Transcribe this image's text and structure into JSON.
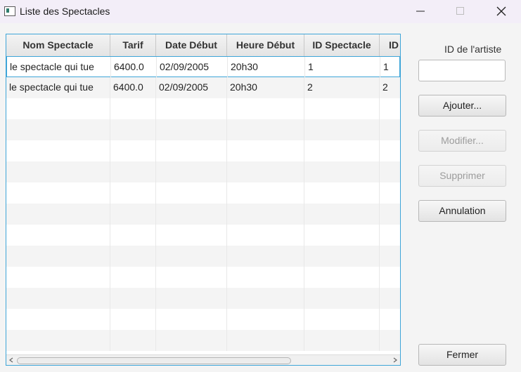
{
  "window": {
    "title": "Liste des Spectacles",
    "icons": {
      "minimize": "minimize-icon",
      "maximize": "maximize-icon",
      "close": "close-icon",
      "app": "app-icon"
    }
  },
  "table": {
    "columns": [
      "Nom Spectacle",
      "Tarif",
      "Date Début",
      "Heure Début",
      "ID Spectacle",
      "ID"
    ],
    "rows": [
      [
        "le spectacle qui tue",
        "6400.0",
        "02/09/2005",
        "20h30",
        "1",
        "1"
      ],
      [
        "le spectacle qui tue",
        "6400.0",
        "02/09/2005",
        "20h30",
        "2",
        "2"
      ]
    ],
    "selected_row": 0,
    "horizontal_scroll_fraction": 0.0
  },
  "sidebar": {
    "artist_id_label": "ID de l'artiste",
    "artist_id_value": "",
    "buttons": {
      "add": "Ajouter...",
      "modify": "Modifier...",
      "delete": "Supprimer",
      "cancel": "Annulation",
      "close": "Fermer"
    }
  },
  "colors": {
    "focus_border": "#3ea5d8",
    "title_bar": "#f3eef8",
    "disabled_text": "#9c9c9c"
  }
}
